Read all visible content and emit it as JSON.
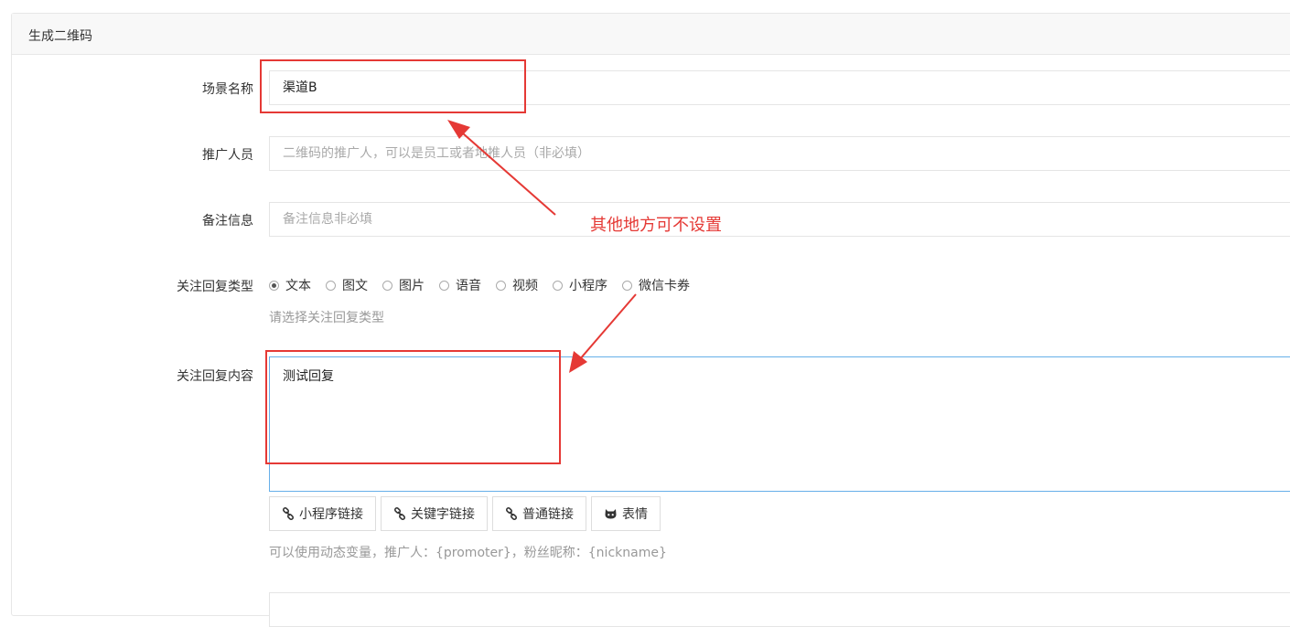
{
  "panel": {
    "title": "生成二维码"
  },
  "form": {
    "scene_name": {
      "label": "场景名称",
      "value": "渠道B"
    },
    "promoter": {
      "label": "推广人员",
      "placeholder": "二维码的推广人，可以是员工或者地推人员（非必填）"
    },
    "remark": {
      "label": "备注信息",
      "placeholder": "备注信息非必填"
    },
    "reply_type": {
      "label": "关注回复类型",
      "options": [
        "文本",
        "图文",
        "图片",
        "语音",
        "视频",
        "小程序",
        "微信卡券"
      ],
      "selected": "文本",
      "help": "请选择关注回复类型"
    },
    "reply_content": {
      "label": "关注回复内容",
      "value": "测试回复",
      "buttons": [
        {
          "label": "小程序链接",
          "icon": "link-icon"
        },
        {
          "label": "关键字链接",
          "icon": "link-icon"
        },
        {
          "label": "普通链接",
          "icon": "link-icon"
        },
        {
          "label": "表情",
          "icon": "github-cat-icon"
        }
      ],
      "help": "可以使用动态变量，推广人：{promoter}，粉丝昵称：{nickname}"
    }
  },
  "annotation": {
    "text": "其他地方可不设置",
    "color": "#e53935"
  }
}
